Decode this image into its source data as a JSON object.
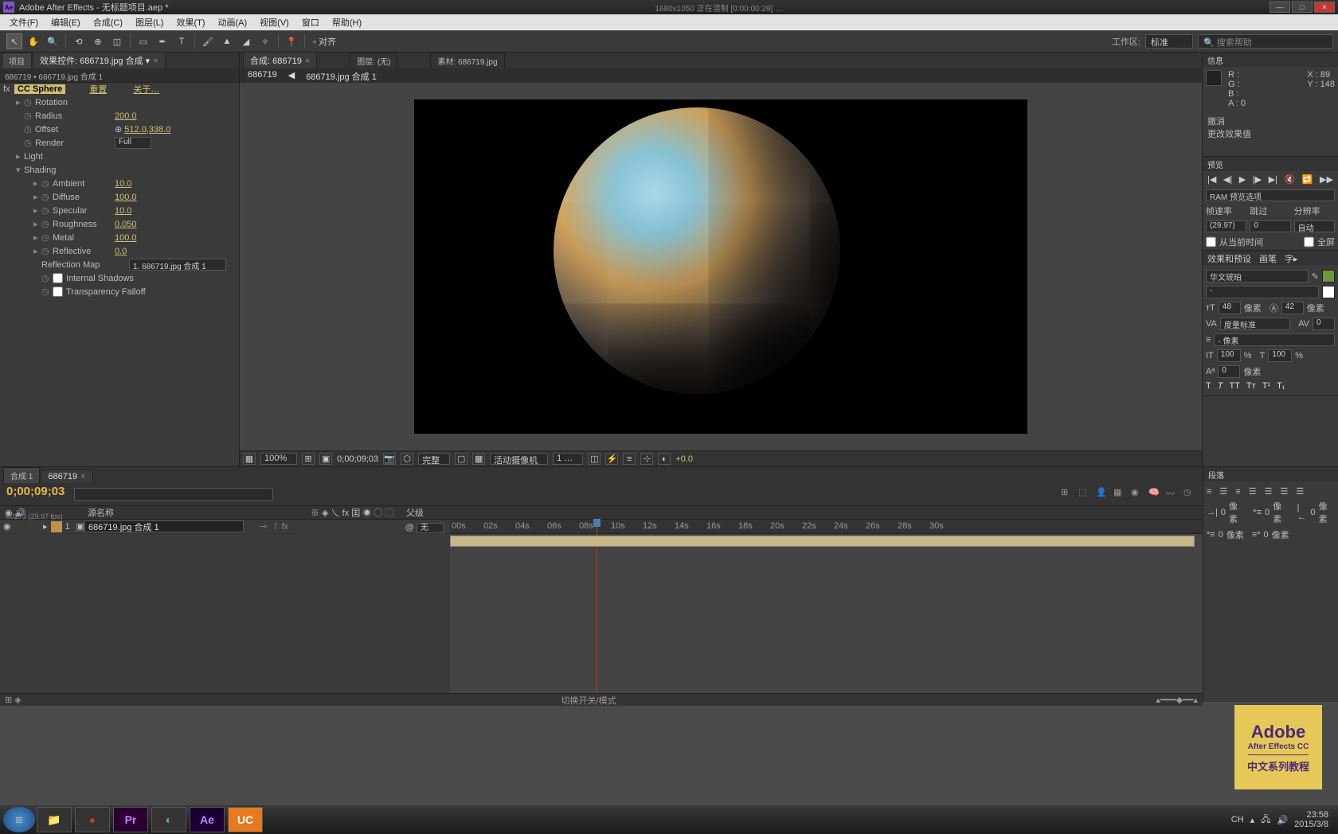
{
  "title": {
    "app": "Adobe After Effects - 无标题项目.aep *",
    "render": "1680x1050  正在渲制 [0:00:00:29] …"
  },
  "menu": [
    "文件(F)",
    "编辑(E)",
    "合成(C)",
    "图层(L)",
    "效果(T)",
    "动画(A)",
    "视图(V)",
    "窗口",
    "帮助(H)"
  ],
  "workspace": {
    "label": "工作区:",
    "value": "标准",
    "search": "搜索帮助"
  },
  "left": {
    "tab_project": "项目",
    "tab_effect": "效果控件: 686719.jpg 合成 ▾",
    "breadcrumb": "686719 • 686719.jpg 合成 1",
    "effect": "CC Sphere",
    "link_reset": "重置",
    "link_about": "关于…",
    "props": {
      "rotation": "Rotation",
      "radius": {
        "l": "Radius",
        "v": "200.0"
      },
      "offset": {
        "l": "Offset",
        "v": "512.0,338.0"
      },
      "render": {
        "l": "Render",
        "v": "Full"
      },
      "light": "Light",
      "shading": "Shading",
      "ambient": {
        "l": "Ambient",
        "v": "10.0"
      },
      "diffuse": {
        "l": "Diffuse",
        "v": "100.0"
      },
      "specular": {
        "l": "Specular",
        "v": "10.0"
      },
      "roughness": {
        "l": "Roughness",
        "v": "0.050"
      },
      "metal": {
        "l": "Metal",
        "v": "100.0"
      },
      "reflective": {
        "l": "Reflective",
        "v": "0.0"
      },
      "reflmap": {
        "l": "Reflection Map",
        "v": "1. 686719.jpg 合成 1"
      },
      "intshadow": "Internal Shadows",
      "transfall": "Transparency Falloff"
    }
  },
  "center": {
    "tab_comp": "合成: 686719",
    "tab_layer": "图层: (无)",
    "tab_foot": "素材: 686719.jpg",
    "bc1": "686719",
    "bc2": "686719.jpg 合成 1",
    "status": {
      "zoom": "100%",
      "time": "0;00;09;03",
      "res": "完整",
      "cam": "活动摄像机",
      "views": "1 …",
      "exp": "+0.0"
    }
  },
  "right": {
    "info": {
      "tab": "信息",
      "r": "R :",
      "g": "G :",
      "b": "B :",
      "a": "A : 0",
      "x": "X : 89",
      "y": "Y : 148"
    },
    "history": {
      "undo": "撤消",
      "redo": "更改效果值"
    },
    "preview": {
      "tab": "预览",
      "ram": "RAM 预览选项",
      "fr_l": "帧速率",
      "skip_l": "跳过",
      "res_l": "分辨率",
      "fr": "(29.97)",
      "skip": "0",
      "res": "自动",
      "cb1": "从当前时间",
      "cb2": "全屏"
    },
    "effpreset": {
      "tab1": "效果和预设",
      "tab2": "画笔",
      "tab3": "字▸"
    },
    "char": {
      "font": "华文琥珀",
      "sizeL": "48",
      "sizeR": "42",
      "unit": "像素",
      "tracking": "0",
      "scaleV": "100",
      "scaleH": "100",
      "pct": "%",
      "baseline": "0"
    }
  },
  "timeline": {
    "tab1": "合成 1",
    "tab2": "686719",
    "tc": "0;00;09;03",
    "tc_sub": "00273 (29.97 fps)",
    "col_src": "源名称",
    "col_parent": "父级",
    "layer": {
      "num": "1",
      "name": "686719.jpg 合成 1",
      "mode": "无"
    },
    "ticks": [
      "00s",
      "02s",
      "04s",
      "06s",
      "08s",
      "10s",
      "12s",
      "14s",
      "16s",
      "18s",
      "20s",
      "22s",
      "24s",
      "26s",
      "28s",
      "30s"
    ],
    "toggle": "切换开关/模式"
  },
  "para": {
    "tab": "段落",
    "unit": "像素",
    "zero": "0"
  },
  "taskbar": {
    "time": "23:58",
    "date": "2015/3/8",
    "ime": "CH"
  },
  "watermark": {
    "l1": "Adobe",
    "l2": "After Effects CC",
    "l3": "中文系列教程"
  }
}
